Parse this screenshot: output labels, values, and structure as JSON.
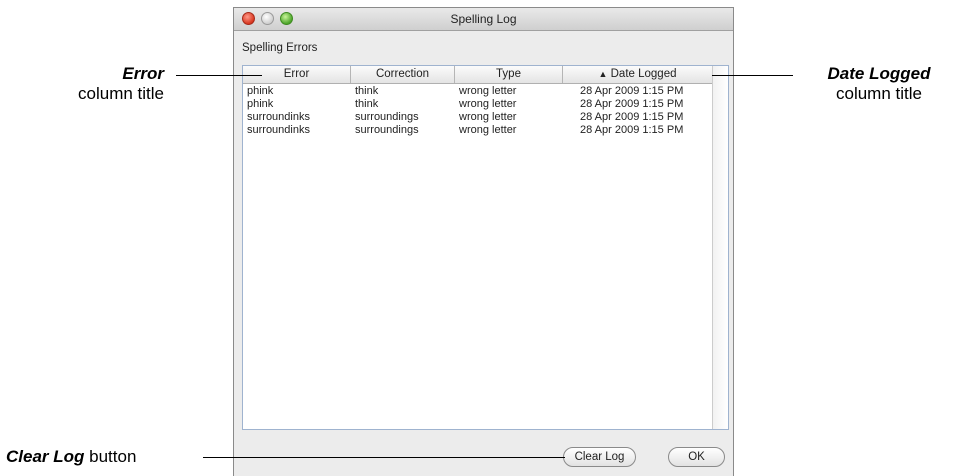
{
  "window": {
    "title": "Spelling Log"
  },
  "section_label": "Spelling Errors",
  "table": {
    "columns": [
      "Error",
      "Correction",
      "Type",
      "Date Logged"
    ],
    "sort_indicator": "▲",
    "rows": [
      [
        "phink",
        "think",
        "wrong letter",
        "28 Apr 2009 1:15 PM"
      ],
      [
        "phink",
        "think",
        "wrong letter",
        "28 Apr 2009 1:15 PM"
      ],
      [
        "surroundinks",
        "surroundings",
        "wrong letter",
        "28 Apr 2009 1:15 PM"
      ],
      [
        "surroundinks",
        "surroundings",
        "wrong letter",
        "28 Apr 2009 1:15 PM"
      ]
    ]
  },
  "buttons": {
    "clear_log": "Clear Log",
    "ok": "OK"
  },
  "callouts": {
    "error": {
      "bold": "Error",
      "rest": "column title"
    },
    "date": {
      "bold": "Date Logged",
      "rest": "column title"
    },
    "clear": {
      "bold": "Clear Log",
      "rest": " button"
    }
  }
}
